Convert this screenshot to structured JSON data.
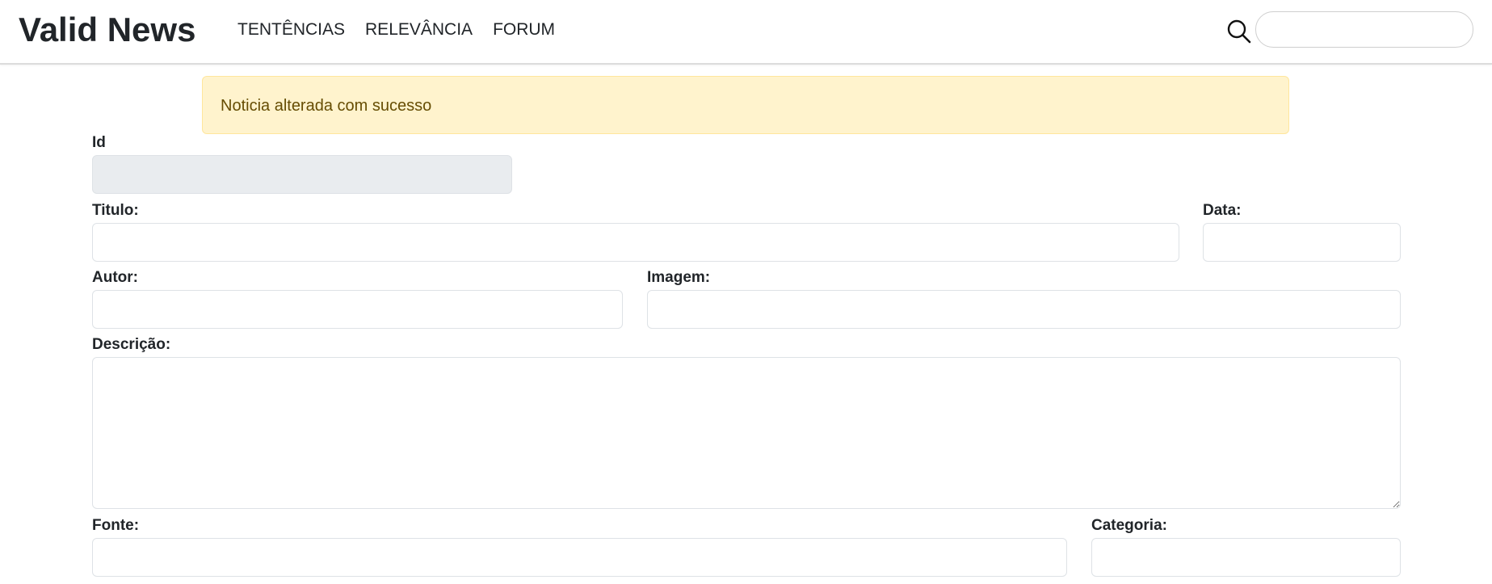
{
  "navbar": {
    "brand": "Valid News",
    "links": [
      "TENTÊNCIAS",
      "RELEVÂNCIA",
      "FORUM"
    ],
    "search": {
      "icon": "search-icon",
      "value": "",
      "placeholder": ""
    }
  },
  "alert": {
    "message": "Noticia alterada com sucesso",
    "background": "#fff3cd",
    "color": "#664d03"
  },
  "form": {
    "id": {
      "label": "Id",
      "value": ""
    },
    "titulo": {
      "label": "Titulo:",
      "value": ""
    },
    "data": {
      "label": "Data:",
      "value": ""
    },
    "autor": {
      "label": "Autor:",
      "value": ""
    },
    "imagem": {
      "label": "Imagem:",
      "value": ""
    },
    "descricao": {
      "label": "Descrição:",
      "value": ""
    },
    "fonte": {
      "label": "Fonte:",
      "value": ""
    },
    "categoria": {
      "label": "Categoria:",
      "value": ""
    }
  }
}
